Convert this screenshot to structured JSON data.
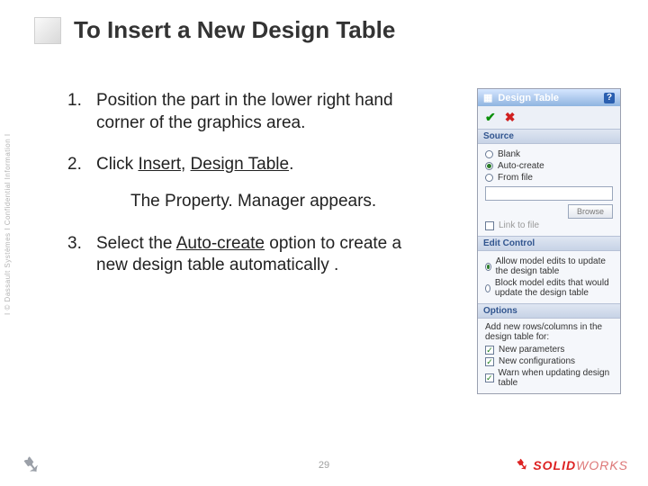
{
  "title": "To Insert a New Design Table",
  "steps": {
    "s1_num": "1.",
    "s1_text": "Position the part in the lower right hand corner of the graphics area.",
    "s2_num": "2.",
    "s2_pre": "Click ",
    "s2_link1": "Insert",
    "s2_mid": ", ",
    "s2_link2": "Design Table",
    "s2_post": ".",
    "sub": "The Property. Manager appears.",
    "s3_num": "3.",
    "s3_pre": "Select the ",
    "s3_link": "Auto-create",
    "s3_post": " option to create a new design table automatically ."
  },
  "copyright": "I © Dassault Systèmes I Confidential Information I",
  "page_number": "29",
  "solidworks": {
    "brand_prefix": "SOLID",
    "brand_suffix": "WORKS"
  },
  "pm": {
    "title": "Design Table",
    "sections": {
      "source": {
        "label": "Source",
        "opt_blank": "Blank",
        "opt_auto": "Auto-create",
        "opt_file": "From file",
        "browse": "Browse",
        "link": "Link to file"
      },
      "edit": {
        "label": "Edit Control",
        "opt1": "Allow model edits to update the design table",
        "opt2": "Block model edits that would update the design table"
      },
      "options": {
        "label": "Options",
        "lead": "Add new rows/columns in the design table for:",
        "c1": "New parameters",
        "c2": "New configurations",
        "c3": "Warn when updating design table"
      }
    }
  }
}
